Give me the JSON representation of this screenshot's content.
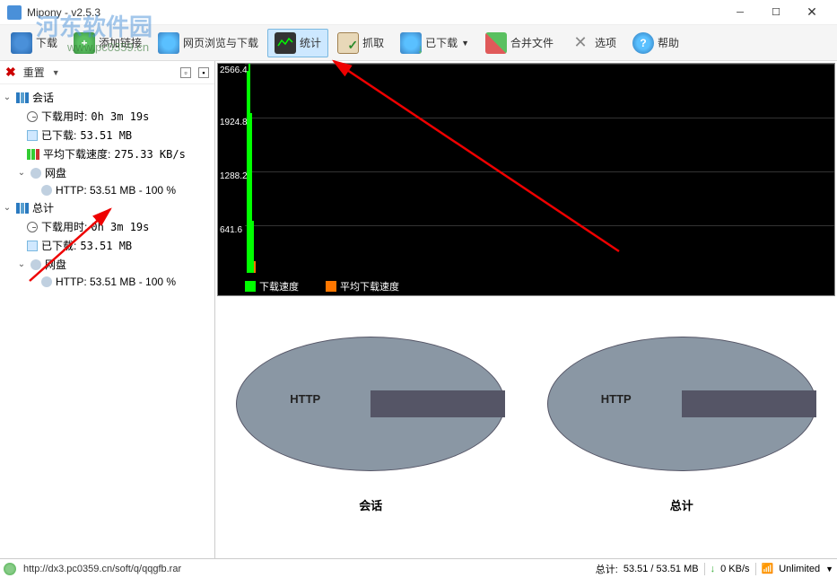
{
  "window": {
    "title": "Mipony - v2.5.3"
  },
  "toolbar": {
    "download": "下载",
    "add_link": "添加链接",
    "browse_download": "网页浏览与下载",
    "statistics": "统计",
    "capture": "抓取",
    "downloaded": "已下载",
    "merge_files": "合并文件",
    "options": "选项",
    "help": "帮助"
  },
  "watermark": {
    "text": "河东软件园",
    "url": "www.pc0359.cn"
  },
  "sidebar_header": {
    "reset": "重置"
  },
  "tree": {
    "session": {
      "label": "会话",
      "download_time_label": "下载用时:",
      "download_time_value": "0h 3m 19s",
      "downloaded_label": "已下载:",
      "downloaded_value": "53.51 MB",
      "avg_speed_label": "平均下载速度:",
      "avg_speed_value": "275.33 KB/s",
      "netdisk_label": "网盘",
      "http_line": "HTTP: 53.51 MB - 100 %"
    },
    "total": {
      "label": "总计",
      "download_time_label": "下载用时:",
      "download_time_value": "0h 3m 19s",
      "downloaded_label": "已下载:",
      "downloaded_value": "53.51 MB",
      "netdisk_label": "网盘",
      "http_line": "HTTP: 53.51 MB - 100 %"
    }
  },
  "chart_data": {
    "type": "line",
    "title": "",
    "xlabel": "",
    "ylabel": "",
    "ylim": [
      0,
      2566.4
    ],
    "y_ticks": [
      641.6,
      1288.2,
      1924.8,
      2566.4
    ],
    "series": [
      {
        "name": "下载速度",
        "color": "#00ff00",
        "values": [
          2400,
          2566,
          1800,
          600,
          50,
          0,
          0,
          0
        ]
      },
      {
        "name": "平均下载速度",
        "color": "#ff7700",
        "values": []
      }
    ],
    "legend": {
      "download_speed": "下载速度",
      "avg_download_speed": "平均下载速度"
    }
  },
  "pies": {
    "left": {
      "label": "HTTP",
      "title": "会话"
    },
    "right": {
      "label": "HTTP",
      "title": "总计"
    }
  },
  "statusbar": {
    "url": "http://dx3.pc0359.cn/soft/q/qqgfb.rar",
    "total_label": "总计:",
    "total_value": "53.51 / 53.51 MB",
    "speed": "0 KB/s",
    "unlimited": "Unlimited"
  }
}
